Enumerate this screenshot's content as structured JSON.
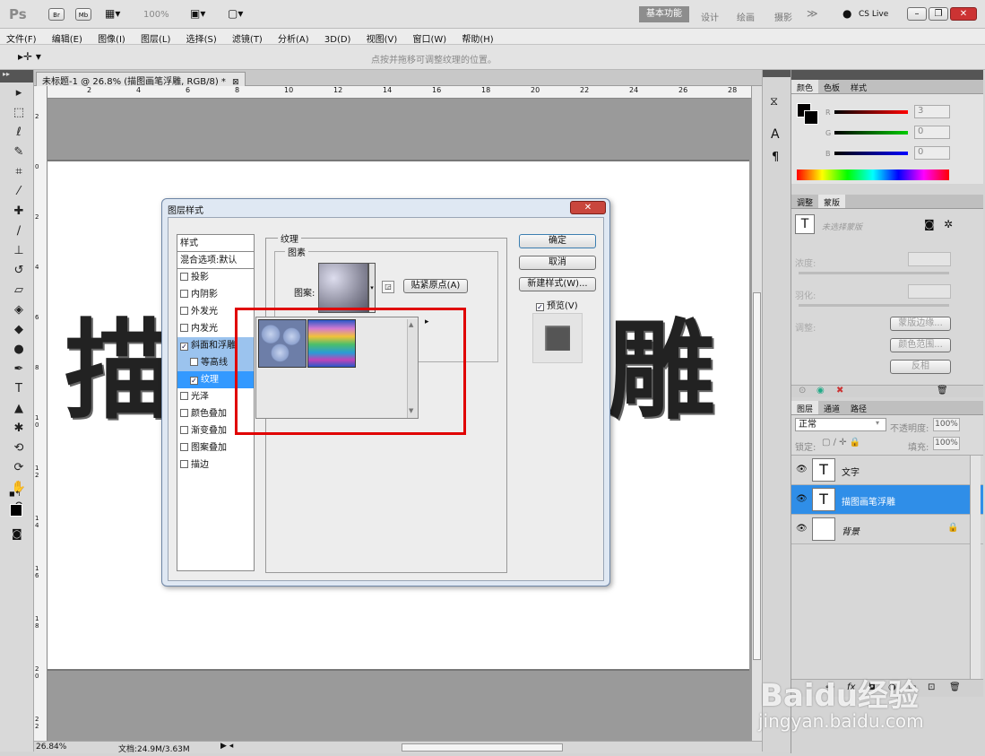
{
  "app": {
    "logo": "Ps"
  },
  "topbar": {
    "zoom": "100%",
    "workspaces": [
      "基本功能",
      "设计",
      "绘画",
      "摄影"
    ],
    "cslive": "CS Live"
  },
  "menu": [
    "文件(F)",
    "编辑(E)",
    "图像(I)",
    "图层(L)",
    "选择(S)",
    "滤镜(T)",
    "分析(A)",
    "3D(D)",
    "视图(V)",
    "窗口(W)",
    "帮助(H)"
  ],
  "options": {
    "hint": "点按并拖移可调整纹理的位置。"
  },
  "document": {
    "tab_title": "未标题-1 @ 26.8% (描图画笔浮雕, RGB/8) *",
    "canvas_text_left": "描",
    "canvas_text_right": "雕",
    "ruler_h": [
      "2",
      "4",
      "6",
      "8",
      "10",
      "12",
      "14",
      "16",
      "18",
      "20",
      "22",
      "24",
      "26",
      "28"
    ],
    "ruler_v": [
      "2",
      "0",
      "2",
      "4",
      "6",
      "8",
      "1 0",
      "1 2",
      "1 4",
      "1 6",
      "1 8",
      "2 0",
      "2 2"
    ]
  },
  "status": {
    "zoom": "26.84%",
    "doc": "文档:24.9M/3.63M"
  },
  "dialog": {
    "title": "图层样式",
    "styles_header": "样式",
    "blend_options": "混合选项:默认",
    "styles": [
      {
        "label": "投影",
        "checked": false
      },
      {
        "label": "内阴影",
        "checked": false
      },
      {
        "label": "外发光",
        "checked": false
      },
      {
        "label": "内发光",
        "checked": false
      },
      {
        "label": "斜面和浮雕",
        "checked": true
      },
      {
        "label": "等高线",
        "checked": false
      },
      {
        "label": "纹理",
        "checked": true
      },
      {
        "label": "光泽",
        "checked": false
      },
      {
        "label": "颜色叠加",
        "checked": false
      },
      {
        "label": "渐变叠加",
        "checked": false
      },
      {
        "label": "图案叠加",
        "checked": false
      },
      {
        "label": "描边",
        "checked": false
      }
    ],
    "section_title": "纹理",
    "group_title": "图素",
    "pattern_label": "图案:",
    "snap_button": "贴紧原点(A)",
    "ok": "确定",
    "cancel": "取消",
    "new_style": "新建样式(W)...",
    "preview": "预览(V)"
  },
  "panels": {
    "color_tabs": [
      "颜色",
      "色板",
      "样式"
    ],
    "color": {
      "r_label": "R",
      "r": "3",
      "g_label": "G",
      "g": "0",
      "b_label": "B",
      "b": "0"
    },
    "adjust_tabs": [
      "调整",
      "蒙版"
    ],
    "masks": {
      "no_selection": "未选择蒙版",
      "density": "浓度:",
      "feather": "羽化:",
      "refine": "调整:",
      "mask_edge": "蒙版边缘...",
      "color_range": "颜色范围...",
      "invert": "反相"
    },
    "layer_tabs": [
      "图层",
      "通道",
      "路径"
    ],
    "layers_panel": {
      "blend_mode": "正常",
      "opacity_label": "不透明度:",
      "opacity": "100%",
      "lock_label": "锁定:",
      "fill_label": "填充:",
      "fill": "100%",
      "layers": [
        {
          "name": "文字",
          "type": "T",
          "selected": false
        },
        {
          "name": "描图画笔浮雕",
          "type": "T",
          "selected": true
        },
        {
          "name": "背景",
          "type": "bg",
          "selected": false
        }
      ]
    }
  },
  "watermark": {
    "brand": "Baidu经验",
    "url": "jingyan.baidu.com"
  }
}
